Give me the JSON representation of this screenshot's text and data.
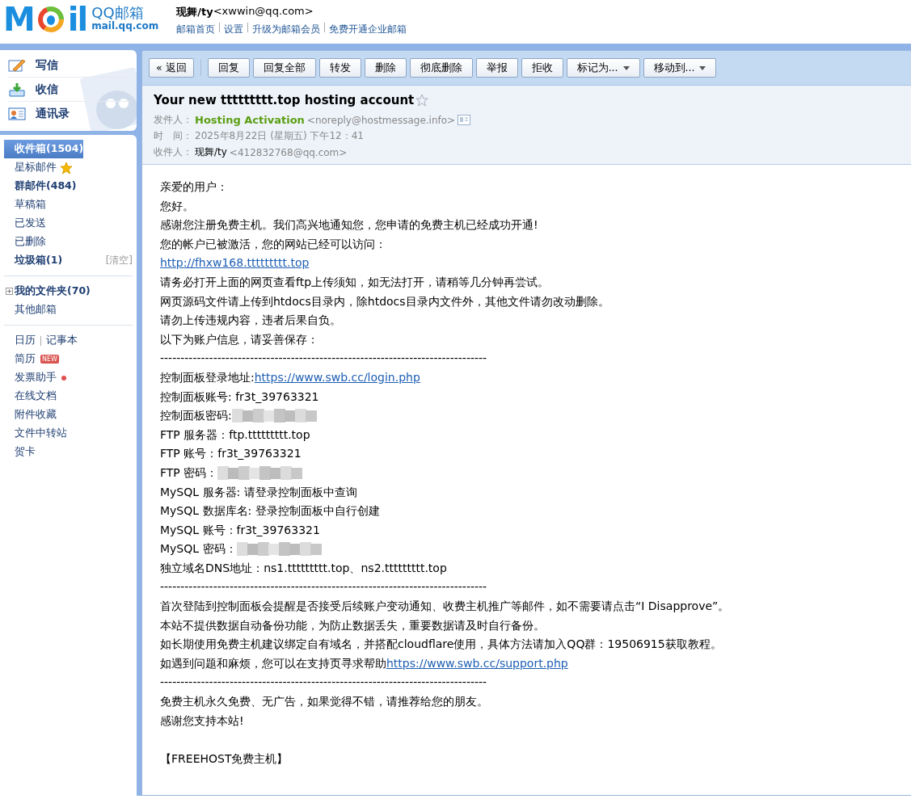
{
  "header": {
    "logo": {
      "left": "M",
      "right": "il",
      "name": "QQ邮箱",
      "domain": "mail.qq.com"
    },
    "user": {
      "name": "现舞/ty",
      "email": "<xwwin@qq.com>"
    },
    "links": [
      "邮箱首页",
      "设置",
      "升级为邮箱会员",
      "免费开通企业邮箱"
    ]
  },
  "sidebar": {
    "actions": [
      {
        "label": "写信",
        "kind": "compose"
      },
      {
        "label": "收信",
        "kind": "receive"
      },
      {
        "label": "通讯录",
        "kind": "contacts"
      }
    ],
    "folders": [
      {
        "label": "收件箱(1504)",
        "bold": true,
        "selected": true
      },
      {
        "label": "星标邮件",
        "bold": false,
        "selected": false,
        "starred": true
      },
      {
        "label": "群邮件(484)",
        "bold": true,
        "selected": false
      },
      {
        "label": "草稿箱",
        "bold": false,
        "selected": false
      },
      {
        "label": "已发送",
        "bold": false,
        "selected": false
      },
      {
        "label": "已删除",
        "bold": false,
        "selected": false
      },
      {
        "label": "垃圾箱(1)",
        "bold": true,
        "selected": false,
        "action": "[清空]"
      }
    ],
    "my_folders": [
      {
        "label": "我的文件夹(70)",
        "bold": true,
        "selected": false,
        "expanded": false
      },
      {
        "label": "其他邮箱",
        "bold": false,
        "selected": false
      }
    ],
    "tools": [
      {
        "items": [
          "日历",
          "记事本"
        ]
      },
      {
        "items": [
          "简历"
        ],
        "badge": "NEW"
      },
      {
        "items": [
          "发票助手"
        ],
        "dot": true
      },
      {
        "items": [
          "在线文档"
        ]
      },
      {
        "items": [
          "附件收藏"
        ]
      },
      {
        "items": [
          "文件中转站"
        ]
      },
      {
        "items": [
          "贺卡"
        ]
      }
    ]
  },
  "toolbar": [
    {
      "label": "« 返回",
      "kind": "back"
    },
    {
      "label": "回复",
      "kind": "plain"
    },
    {
      "label": "回复全部",
      "kind": "plain"
    },
    {
      "label": "转发",
      "kind": "plain"
    },
    {
      "label": "删除",
      "kind": "plain"
    },
    {
      "label": "彻底删除",
      "kind": "plain"
    },
    {
      "label": "举报",
      "kind": "plain"
    },
    {
      "label": "拒收",
      "kind": "plain"
    },
    {
      "label": "标记为...",
      "kind": "dropdown"
    },
    {
      "label": "移动到...",
      "kind": "dropdown"
    }
  ],
  "message": {
    "subject": "Your new ttttttttt.top hosting account",
    "starred": false,
    "from": {
      "label": "发件人：",
      "name": "Hosting Activation",
      "email": "<noreply@hostmessage.info>"
    },
    "time": {
      "label": "时　间：",
      "value": "2025年8月22日 (星期五) 下午12：41"
    },
    "to": {
      "label": "收件人：",
      "name": "现舞/ty",
      "email": "<412832768@qq.com>"
    },
    "body": [
      {
        "kind": "text",
        "text": "亲爱的用户："
      },
      {
        "kind": "text",
        "text": "您好。"
      },
      {
        "kind": "text",
        "text": "感谢您注册免费主机。我们高兴地通知您，您申请的免费主机已经成功开通!"
      },
      {
        "kind": "text",
        "text": "您的帐户已被激活，您的网站已经可以访问："
      },
      {
        "kind": "link",
        "link": "http://fhxw168.ttttttttt.top"
      },
      {
        "kind": "text",
        "text": "请务必打开上面的网页查看ftp上传须知，如无法打开，请稍等几分钟再尝试。"
      },
      {
        "kind": "text",
        "text": "网页源码文件请上传到htdocs目录内，除htdocs目录内文件外，其他文件请勿改动删除。"
      },
      {
        "kind": "text",
        "text": "请勿上传违规内容，违者后果自负。"
      },
      {
        "kind": "text",
        "text": "以下为账户信息，请妥善保存："
      },
      {
        "kind": "text",
        "text": "--------------------------------------------------------------------------------"
      },
      {
        "kind": "text_link",
        "text": "控制面板登录地址: ",
        "link": "https://www.swb.cc/login.php"
      },
      {
        "kind": "text",
        "text": "控制面板账号: fr3t_39763321"
      },
      {
        "kind": "redacted",
        "text": "控制面板密码: "
      },
      {
        "kind": "text",
        "text": "FTP 服务器：ftp.ttttttttt.top"
      },
      {
        "kind": "text",
        "text": "FTP 账号：fr3t_39763321"
      },
      {
        "kind": "redacted",
        "text": "FTP 密码："
      },
      {
        "kind": "text",
        "text": "MySQL 服务器: 请登录控制面板中查询"
      },
      {
        "kind": "text",
        "text": "MySQL 数据库名: 登录控制面板中自行创建"
      },
      {
        "kind": "text",
        "text": "MySQL 账号：fr3t_39763321"
      },
      {
        "kind": "redacted",
        "text": "MySQL 密码："
      },
      {
        "kind": "text",
        "text": "独立域名DNS地址：ns1.ttttttttt.top、ns2.ttttttttt.top"
      },
      {
        "kind": "text",
        "text": "--------------------------------------------------------------------------------"
      },
      {
        "kind": "text",
        "text": "首次登陆到控制面板会提醒是否接受后续账户变动通知、收费主机推广等邮件，如不需要请点击“I Disapprove”。"
      },
      {
        "kind": "text",
        "text": "本站不提供数据自动备份功能，为防止数据丢失，重要数据请及时自行备份。"
      },
      {
        "kind": "text",
        "text": "如长期使用免费主机建议绑定自有域名，并搭配cloudflare使用，具体方法请加入QQ群：19506915获取教程。"
      },
      {
        "kind": "text_link",
        "text": "如遇到问题和麻烦，您可以在支持页寻求帮助",
        "link": "https://www.swb.cc/support.php"
      },
      {
        "kind": "text",
        "text": "--------------------------------------------------------------------------------"
      },
      {
        "kind": "text",
        "text": "免费主机永久免费、无广告，如果觉得不错，请推荐给您的朋友。"
      },
      {
        "kind": "text",
        "text": "感谢您支持本站!"
      },
      {
        "kind": "blank"
      },
      {
        "kind": "text",
        "text": "【FREEHOST免费主机】"
      }
    ]
  }
}
